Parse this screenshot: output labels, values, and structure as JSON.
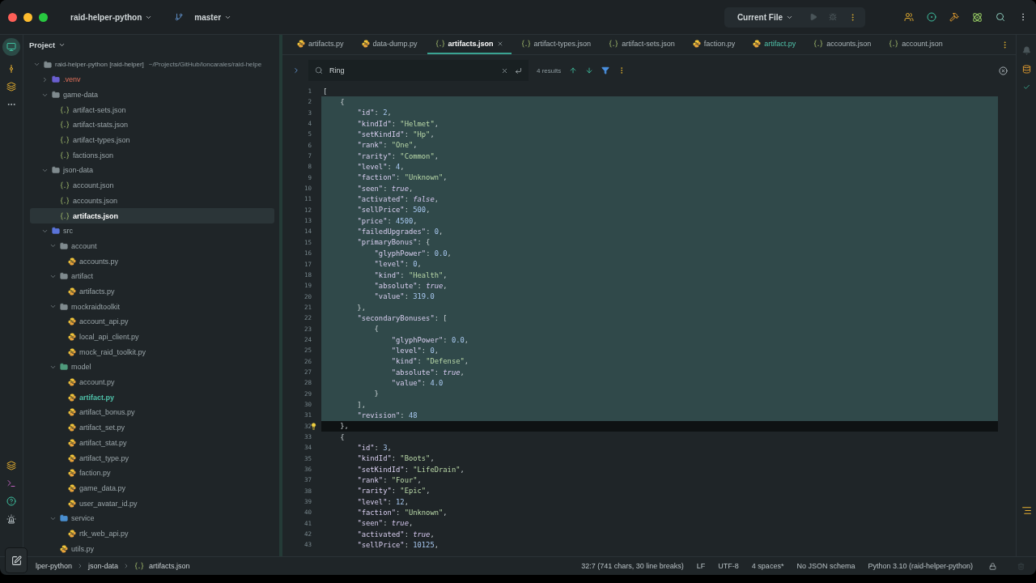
{
  "titlebar": {
    "project": "raid-helper-python",
    "branch": "master",
    "run_config": "Current File"
  },
  "project_panel": {
    "title": "Project",
    "tree": [
      {
        "label": "raid-helper-python [raid-helper]",
        "path": "~/Projects/GitHub/loncarales/raid-helpe",
        "kind": "folder",
        "expanded": true,
        "selected": false,
        "modified": false,
        "children": [
          {
            "label": ".venv",
            "kind": "venv",
            "expanded": false,
            "selected": false,
            "modified": false
          },
          {
            "label": "game-data",
            "kind": "folder",
            "expanded": true,
            "selected": false,
            "modified": false,
            "children": [
              {
                "label": "artifact-sets.json",
                "kind": "json",
                "selected": false,
                "modified": false
              },
              {
                "label": "artifact-stats.json",
                "kind": "json",
                "selected": false,
                "modified": false
              },
              {
                "label": "artifact-types.json",
                "kind": "json",
                "selected": false,
                "modified": false
              },
              {
                "label": "factions.json",
                "kind": "json",
                "selected": false,
                "modified": false
              }
            ]
          },
          {
            "label": "json-data",
            "kind": "folder",
            "expanded": true,
            "selected": false,
            "modified": false,
            "children": [
              {
                "label": "account.json",
                "kind": "json",
                "selected": false,
                "modified": false
              },
              {
                "label": "accounts.json",
                "kind": "json",
                "selected": false,
                "modified": false
              },
              {
                "label": "artifacts.json",
                "kind": "json",
                "selected": true,
                "modified": false
              }
            ]
          },
          {
            "label": "src",
            "kind": "source",
            "expanded": true,
            "selected": false,
            "modified": false,
            "children": [
              {
                "label": "account",
                "kind": "folder",
                "expanded": true,
                "selected": false,
                "modified": false,
                "children": [
                  {
                    "label": "accounts.py",
                    "kind": "python",
                    "selected": false,
                    "modified": false
                  }
                ]
              },
              {
                "label": "artifact",
                "kind": "folder",
                "expanded": true,
                "selected": false,
                "modified": false,
                "children": [
                  {
                    "label": "artifacts.py",
                    "kind": "python",
                    "selected": false,
                    "modified": false
                  }
                ]
              },
              {
                "label": "mockraidtoolkit",
                "kind": "folder",
                "expanded": true,
                "selected": false,
                "modified": false,
                "children": [
                  {
                    "label": "account_api.py",
                    "kind": "python",
                    "selected": false,
                    "modified": false
                  },
                  {
                    "label": "local_api_client.py",
                    "kind": "python",
                    "selected": false,
                    "modified": false
                  },
                  {
                    "label": "mock_raid_toolkit.py",
                    "kind": "python",
                    "selected": false,
                    "modified": false
                  }
                ]
              },
              {
                "label": "model",
                "kind": "package",
                "expanded": true,
                "selected": false,
                "modified": false,
                "children": [
                  {
                    "label": "account.py",
                    "kind": "python",
                    "selected": false,
                    "modified": false
                  },
                  {
                    "label": "artifact.py",
                    "kind": "python",
                    "selected": false,
                    "modified": true
                  },
                  {
                    "label": "artifact_bonus.py",
                    "kind": "python",
                    "selected": false,
                    "modified": false
                  },
                  {
                    "label": "artifact_set.py",
                    "kind": "python",
                    "selected": false,
                    "modified": false
                  },
                  {
                    "label": "artifact_stat.py",
                    "kind": "python",
                    "selected": false,
                    "modified": false
                  },
                  {
                    "label": "artifact_type.py",
                    "kind": "python",
                    "selected": false,
                    "modified": false
                  },
                  {
                    "label": "faction.py",
                    "kind": "python",
                    "selected": false,
                    "modified": false
                  },
                  {
                    "label": "game_data.py",
                    "kind": "python",
                    "selected": false,
                    "modified": false
                  },
                  {
                    "label": "user_avatar_id.py",
                    "kind": "python",
                    "selected": false,
                    "modified": false
                  }
                ]
              },
              {
                "label": "service",
                "kind": "service",
                "expanded": true,
                "selected": false,
                "modified": false,
                "children": [
                  {
                    "label": "rtk_web_api.py",
                    "kind": "python",
                    "selected": false,
                    "modified": false
                  }
                ]
              },
              {
                "label": "utils.py",
                "kind": "python",
                "selected": false,
                "modified": false
              }
            ]
          }
        ]
      }
    ]
  },
  "tabs": [
    {
      "label": "artifacts.py",
      "kind": "python",
      "selected": false,
      "modified": false
    },
    {
      "label": "data-dump.py",
      "kind": "python",
      "selected": false,
      "modified": false
    },
    {
      "label": "artifacts.json",
      "kind": "json",
      "selected": true,
      "modified": false
    },
    {
      "label": "artifact-types.json",
      "kind": "json",
      "selected": false,
      "modified": false
    },
    {
      "label": "artifact-sets.json",
      "kind": "json",
      "selected": false,
      "modified": false
    },
    {
      "label": "faction.py",
      "kind": "python",
      "selected": false,
      "modified": false
    },
    {
      "label": "artifact.py",
      "kind": "python",
      "selected": false,
      "modified": true
    },
    {
      "label": "accounts.json",
      "kind": "json",
      "selected": false,
      "modified": false
    },
    {
      "label": "account.json",
      "kind": "json",
      "selected": false,
      "modified": false
    }
  ],
  "search": {
    "query": "Ring",
    "results": "4 results"
  },
  "code_lines": [
    {
      "number": "1",
      "text": "[",
      "highlighted": false,
      "current": false
    },
    {
      "number": "2",
      "text": "    {",
      "highlighted": true,
      "current": false
    },
    {
      "number": "3",
      "text": "        \"id\": 2,",
      "highlighted": true,
      "current": false
    },
    {
      "number": "4",
      "text": "        \"kindId\": \"Helmet\",",
      "highlighted": true,
      "current": false
    },
    {
      "number": "5",
      "text": "        \"setKindId\": \"Hp\",",
      "highlighted": true,
      "current": false
    },
    {
      "number": "6",
      "text": "        \"rank\": \"One\",",
      "highlighted": true,
      "current": false
    },
    {
      "number": "7",
      "text": "        \"rarity\": \"Common\",",
      "highlighted": true,
      "current": false
    },
    {
      "number": "8",
      "text": "        \"level\": 4,",
      "highlighted": true,
      "current": false
    },
    {
      "number": "9",
      "text": "        \"faction\": \"Unknown\",",
      "highlighted": true,
      "current": false
    },
    {
      "number": "10",
      "text": "        \"seen\": true,",
      "highlighted": true,
      "current": false
    },
    {
      "number": "11",
      "text": "        \"activated\": false,",
      "highlighted": true,
      "current": false
    },
    {
      "number": "12",
      "text": "        \"sellPrice\": 500,",
      "highlighted": true,
      "current": false
    },
    {
      "number": "13",
      "text": "        \"price\": 4500,",
      "highlighted": true,
      "current": false
    },
    {
      "number": "14",
      "text": "        \"failedUpgrades\": 0,",
      "highlighted": true,
      "current": false
    },
    {
      "number": "15",
      "text": "        \"primaryBonus\": {",
      "highlighted": true,
      "current": false
    },
    {
      "number": "16",
      "text": "            \"glyphPower\": 0.0,",
      "highlighted": true,
      "current": false
    },
    {
      "number": "17",
      "text": "            \"level\": 0,",
      "highlighted": true,
      "current": false
    },
    {
      "number": "18",
      "text": "            \"kind\": \"Health\",",
      "highlighted": true,
      "current": false
    },
    {
      "number": "19",
      "text": "            \"absolute\": true,",
      "highlighted": true,
      "current": false
    },
    {
      "number": "20",
      "text": "            \"value\": 319.0",
      "highlighted": true,
      "current": false
    },
    {
      "number": "21",
      "text": "        },",
      "highlighted": true,
      "current": false
    },
    {
      "number": "22",
      "text": "        \"secondaryBonuses\": [",
      "highlighted": true,
      "current": false
    },
    {
      "number": "23",
      "text": "            {",
      "highlighted": true,
      "current": false
    },
    {
      "number": "24",
      "text": "                \"glyphPower\": 0.0,",
      "highlighted": true,
      "current": false
    },
    {
      "number": "25",
      "text": "                \"level\": 0,",
      "highlighted": true,
      "current": false
    },
    {
      "number": "26",
      "text": "                \"kind\": \"Defense\",",
      "highlighted": true,
      "current": false
    },
    {
      "number": "27",
      "text": "                \"absolute\": true,",
      "highlighted": true,
      "current": false
    },
    {
      "number": "28",
      "text": "                \"value\": 4.0",
      "highlighted": true,
      "current": false
    },
    {
      "number": "29",
      "text": "            }",
      "highlighted": true,
      "current": false
    },
    {
      "number": "30",
      "text": "        ],",
      "highlighted": true,
      "current": false
    },
    {
      "number": "31",
      "text": "        \"revision\": 48",
      "highlighted": true,
      "current": false
    },
    {
      "number": "32",
      "text": "    },",
      "highlighted": false,
      "current": true
    },
    {
      "number": "33",
      "text": "    {",
      "highlighted": false,
      "current": false
    },
    {
      "number": "34",
      "text": "        \"id\": 3,",
      "highlighted": false,
      "current": false
    },
    {
      "number": "35",
      "text": "        \"kindId\": \"Boots\",",
      "highlighted": false,
      "current": false
    },
    {
      "number": "36",
      "text": "        \"setKindId\": \"LifeDrain\",",
      "highlighted": false,
      "current": false
    },
    {
      "number": "37",
      "text": "        \"rank\": \"Four\",",
      "highlighted": false,
      "current": false
    },
    {
      "number": "38",
      "text": "        \"rarity\": \"Epic\",",
      "highlighted": false,
      "current": false
    },
    {
      "number": "39",
      "text": "        \"level\": 12,",
      "highlighted": false,
      "current": false
    },
    {
      "number": "40",
      "text": "        \"faction\": \"Unknown\",",
      "highlighted": false,
      "current": false
    },
    {
      "number": "41",
      "text": "        \"seen\": true,",
      "highlighted": false,
      "current": false
    },
    {
      "number": "42",
      "text": "        \"activated\": true,",
      "highlighted": false,
      "current": false
    },
    {
      "number": "43",
      "text": "        \"sellPrice\": 10125,",
      "highlighted": false,
      "current": false
    }
  ],
  "breadcrumb": [
    {
      "label": "lper-python",
      "kind": "folder"
    },
    {
      "label": "json-data",
      "kind": "folder"
    },
    {
      "label": "artifacts.json",
      "kind": "json"
    }
  ],
  "status_bar": [
    "32:7 (741 chars, 30 line breaks)",
    "LF",
    "UTF-8",
    "4 spaces*",
    "No JSON schema",
    "Python 3.10 (raid-helper-python)"
  ]
}
